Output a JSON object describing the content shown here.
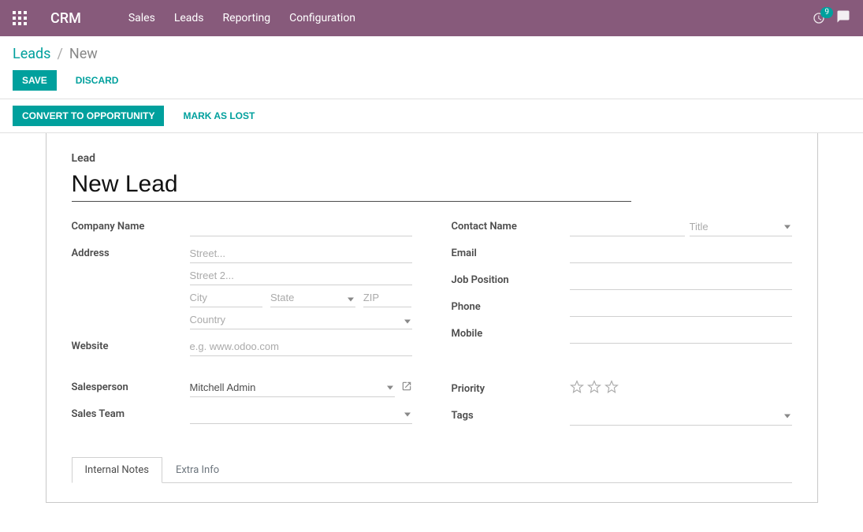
{
  "navbar": {
    "brand": "CRM",
    "items": [
      "Sales",
      "Leads",
      "Reporting",
      "Configuration"
    ],
    "badge_count": "9"
  },
  "breadcrumb": {
    "parent": "Leads",
    "current": "New"
  },
  "controls": {
    "save": "Save",
    "discard": "Discard"
  },
  "status": {
    "convert": "Convert to Opportunity",
    "lost": "Mark as Lost"
  },
  "form": {
    "lead_label": "Lead",
    "title": "New Lead",
    "left": {
      "company_name": {
        "label": "Company Name",
        "value": ""
      },
      "address": {
        "label": "Address",
        "street_ph": "Street...",
        "street2_ph": "Street 2...",
        "city_ph": "City",
        "state_ph": "State",
        "zip_ph": "ZIP",
        "country_ph": "Country"
      },
      "website": {
        "label": "Website",
        "placeholder": "e.g. www.odoo.com"
      },
      "salesperson": {
        "label": "Salesperson",
        "value": "Mitchell Admin"
      },
      "sales_team": {
        "label": "Sales Team",
        "value": ""
      }
    },
    "right": {
      "contact_name": {
        "label": "Contact Name",
        "name_value": "",
        "title_ph": "Title"
      },
      "email": {
        "label": "Email",
        "value": ""
      },
      "job_position": {
        "label": "Job Position",
        "value": ""
      },
      "phone": {
        "label": "Phone",
        "value": ""
      },
      "mobile": {
        "label": "Mobile",
        "value": ""
      },
      "priority": {
        "label": "Priority"
      },
      "tags": {
        "label": "Tags",
        "value": ""
      }
    }
  },
  "tabs": {
    "internal_notes": "Internal Notes",
    "extra_info": "Extra Info"
  }
}
